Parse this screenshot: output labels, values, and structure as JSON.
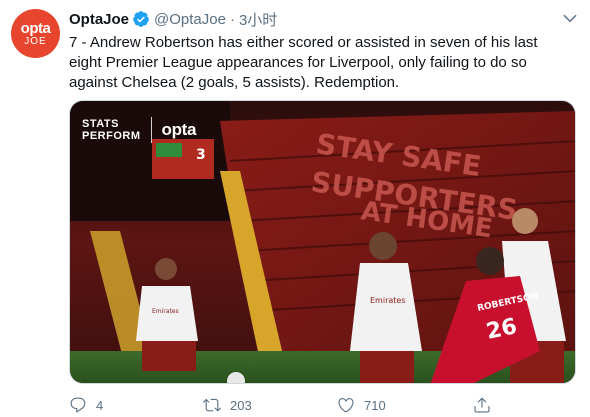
{
  "tweet": {
    "avatar_line1": "opta",
    "avatar_line2": "JOE",
    "name": "OptaJoe",
    "handle": "@OptaJoe",
    "separator": "·",
    "time": "3小时",
    "text": "7 - Andrew Robertson has either scored or assisted in seven of his last eight Premier League appearances for Liverpool, only failing to do so against Chelsea (2 goals, 5 assists). Redemption."
  },
  "media": {
    "brand_stats": "STATS",
    "brand_perform": "PERFORM",
    "brand_opta": "opta",
    "banner_line1": "STAY SAFE",
    "banner_line2": "SUPPORTERS",
    "banner_line3": "AT HOME",
    "player_shirt_name": "ROBERTSON",
    "player_number": "26",
    "scoreboard_number": "3",
    "shirt_text": "Emirates"
  },
  "actions": {
    "reply_count": "4",
    "retweet_count": "203",
    "like_count": "710"
  },
  "colors": {
    "verified": "#1da1f2",
    "brand": "#e8452e",
    "secondary_text": "#5b7083"
  }
}
